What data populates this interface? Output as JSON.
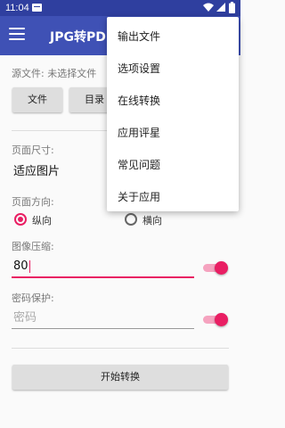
{
  "status_bar": {
    "time": "11:04",
    "icons": [
      "notification-icon",
      "wifi-icon",
      "signal-icon",
      "battery-icon"
    ]
  },
  "toolbar": {
    "title": "JPG转PDF"
  },
  "source": {
    "label": "源文件: 未选择文件",
    "file_button": "文件",
    "dir_button": "目录"
  },
  "page_size": {
    "label": "页面尺寸:",
    "value": "适应图片"
  },
  "orientation": {
    "label": "页面方向:",
    "options": [
      "纵向",
      "横向"
    ],
    "selected": "纵向"
  },
  "compression": {
    "label": "图像压缩:",
    "value": "80",
    "enabled": true
  },
  "password": {
    "label": "密码保护:",
    "placeholder": "密码",
    "enabled": true
  },
  "start_button": "开始转换",
  "overflow_menu": {
    "items": [
      "输出文件",
      "选项设置",
      "在线转换",
      "应用评星",
      "常见问题",
      "关于应用"
    ]
  },
  "colors": {
    "primary": "#3f51b5",
    "status_bar": "#2f3f9f",
    "accent": "#e91e63"
  }
}
